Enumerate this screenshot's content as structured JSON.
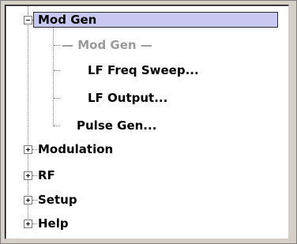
{
  "tree": {
    "mod_gen": {
      "label": "Mod Gen",
      "children": [
        {
          "label": "— Mod Gen —"
        },
        {
          "label": "LF Freq Sweep..."
        },
        {
          "label": "LF Output..."
        },
        {
          "label": "Pulse Gen..."
        }
      ]
    },
    "items": [
      {
        "label": "Modulation"
      },
      {
        "label": "RF"
      },
      {
        "label": "Setup"
      },
      {
        "label": "Help"
      }
    ]
  }
}
